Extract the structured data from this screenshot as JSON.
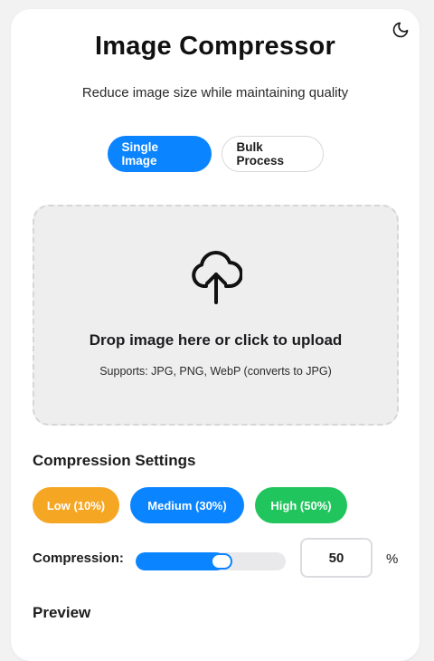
{
  "app": {
    "title": "Image Compressor",
    "subtitle": "Reduce image size while maintaining quality"
  },
  "theme_toggle": {
    "icon": "moon-icon"
  },
  "mode_tabs": [
    {
      "label": "Single Image",
      "active": true
    },
    {
      "label": "Bulk Process",
      "active": false
    }
  ],
  "dropzone": {
    "icon": "cloud-upload-icon",
    "title": "Drop image here or click to upload",
    "supports": "Supports: JPG, PNG, WebP (converts to JPG)"
  },
  "settings": {
    "title": "Compression Settings",
    "presets": [
      {
        "label": "Low (10%)",
        "color": "#f5a623"
      },
      {
        "label": "Medium (30%)",
        "color": "#0a84ff"
      },
      {
        "label": "High (50%)",
        "color": "#21c55d"
      }
    ],
    "compression_label": "Compression:",
    "slider_value": 50,
    "slider_max": 100,
    "input_value": "50",
    "unit": "%"
  },
  "preview": {
    "title": "Preview"
  },
  "colors": {
    "accent": "#0a84ff",
    "low": "#f5a623",
    "high": "#21c55d"
  }
}
